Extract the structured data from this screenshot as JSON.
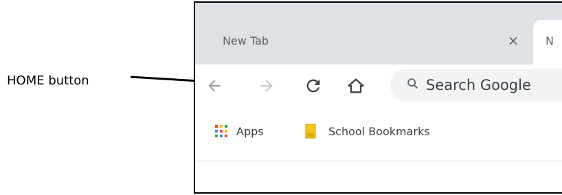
{
  "callout": {
    "label": "HOME button"
  },
  "tabs": [
    {
      "title": "New Tab",
      "active": false
    },
    {
      "title": "N",
      "active": true
    }
  ],
  "tab_close_symbol": "×",
  "toolbar": {
    "icons": [
      "back-arrow-icon",
      "forward-arrow-icon",
      "reload-icon",
      "home-icon"
    ],
    "omnibox_placeholder": "Search Google"
  },
  "bookmarks": [
    {
      "label": "Apps",
      "icon": "apps-grid-icon"
    },
    {
      "label": "School Bookmarks",
      "icon": "folder-icon"
    }
  ],
  "colors": {
    "tabstrip_bg": "#dee1e6",
    "omnibox_bg": "#f1f3f4",
    "icon_dark": "#3c4043",
    "icon_disabled": "#9aa0a6",
    "folder": "#f5c518"
  }
}
